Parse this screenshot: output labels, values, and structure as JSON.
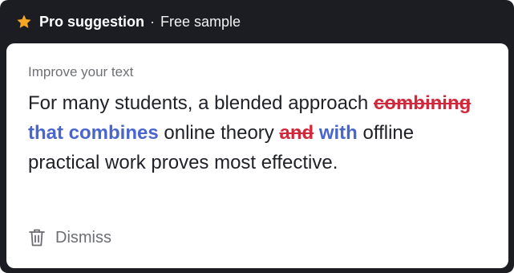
{
  "header": {
    "icon": "star-icon",
    "title": "Pro suggestion",
    "separator": "·",
    "subtitle": "Free sample",
    "accent_color": "#f5a623"
  },
  "card": {
    "heading": "Improve your text",
    "segments": [
      {
        "type": "text",
        "text": "For many students, a blended approach "
      },
      {
        "type": "deleted",
        "text": "combining"
      },
      {
        "type": "text",
        "text": " "
      },
      {
        "type": "inserted",
        "text": "that combines"
      },
      {
        "type": "text",
        "text": " online theory "
      },
      {
        "type": "deleted",
        "text": "and"
      },
      {
        "type": "text",
        "text": " "
      },
      {
        "type": "inserted",
        "text": "with"
      },
      {
        "type": "text",
        "text": " offline practical work proves most effective."
      }
    ],
    "dismiss_label": "Dismiss",
    "dismiss_icon": "trash-icon",
    "deleted_color": "#d2283b",
    "inserted_color": "#4a66cc"
  }
}
